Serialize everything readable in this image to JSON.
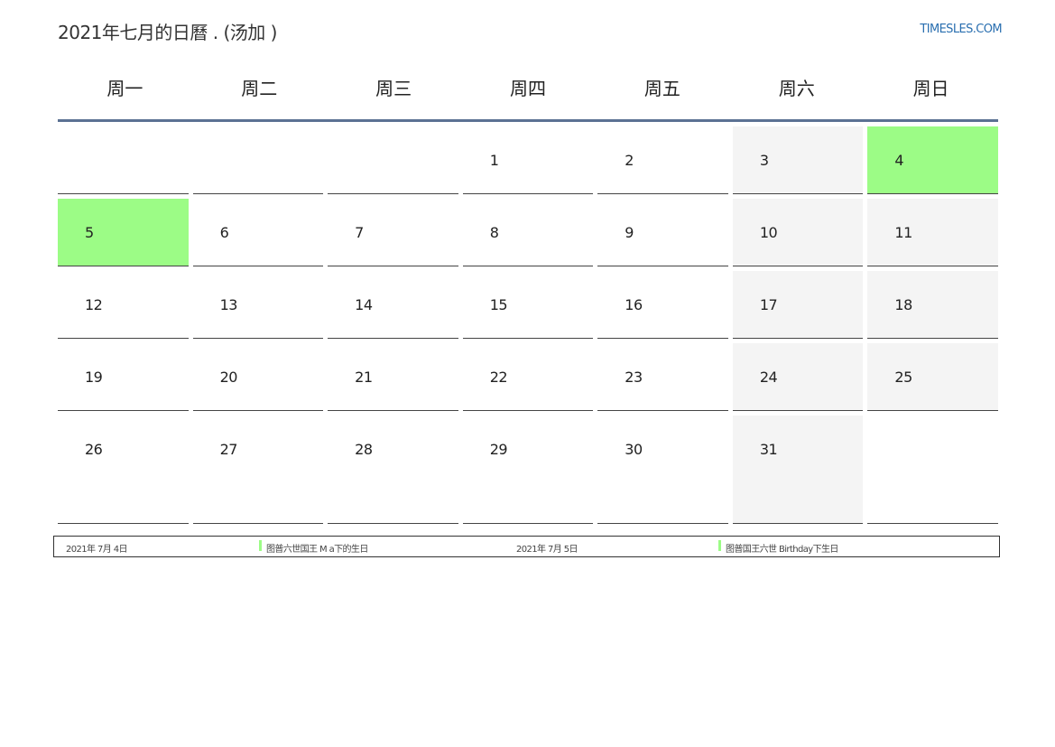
{
  "header": {
    "title": "2021年七月的日曆 . (汤加 )",
    "site": "TIMESLES.COM"
  },
  "colors": {
    "holiday": "#9cfc86",
    "weekend": "#f4f4f4",
    "header_rule": "#5b7193",
    "link": "#2a6fb0"
  },
  "weekdays": [
    "周一",
    "周二",
    "周三",
    "周四",
    "周五",
    "周六",
    "周日"
  ],
  "weeks": [
    [
      {
        "day": "",
        "type": "normal"
      },
      {
        "day": "",
        "type": "normal"
      },
      {
        "day": "",
        "type": "normal"
      },
      {
        "day": "1",
        "type": "normal"
      },
      {
        "day": "2",
        "type": "normal"
      },
      {
        "day": "3",
        "type": "weekend"
      },
      {
        "day": "4",
        "type": "holiday"
      }
    ],
    [
      {
        "day": "5",
        "type": "holiday"
      },
      {
        "day": "6",
        "type": "normal"
      },
      {
        "day": "7",
        "type": "normal"
      },
      {
        "day": "8",
        "type": "normal"
      },
      {
        "day": "9",
        "type": "normal"
      },
      {
        "day": "10",
        "type": "weekend"
      },
      {
        "day": "11",
        "type": "weekend"
      }
    ],
    [
      {
        "day": "12",
        "type": "normal"
      },
      {
        "day": "13",
        "type": "normal"
      },
      {
        "day": "14",
        "type": "normal"
      },
      {
        "day": "15",
        "type": "normal"
      },
      {
        "day": "16",
        "type": "normal"
      },
      {
        "day": "17",
        "type": "weekend"
      },
      {
        "day": "18",
        "type": "weekend"
      }
    ],
    [
      {
        "day": "19",
        "type": "normal"
      },
      {
        "day": "20",
        "type": "normal"
      },
      {
        "day": "21",
        "type": "normal"
      },
      {
        "day": "22",
        "type": "normal"
      },
      {
        "day": "23",
        "type": "normal"
      },
      {
        "day": "24",
        "type": "weekend"
      },
      {
        "day": "25",
        "type": "weekend"
      }
    ],
    [
      {
        "day": "26",
        "type": "normal"
      },
      {
        "day": "27",
        "type": "normal"
      },
      {
        "day": "28",
        "type": "normal"
      },
      {
        "day": "29",
        "type": "normal"
      },
      {
        "day": "30",
        "type": "normal"
      },
      {
        "day": "31",
        "type": "weekend"
      },
      {
        "day": "",
        "type": "normal"
      }
    ]
  ],
  "legend": [
    {
      "date": "2021年 7月 4日",
      "name": "图普六世国王 M a下的生日"
    },
    {
      "date": "2021年 7月 5日",
      "name": "图普国王六世 Birthday下生日"
    }
  ]
}
